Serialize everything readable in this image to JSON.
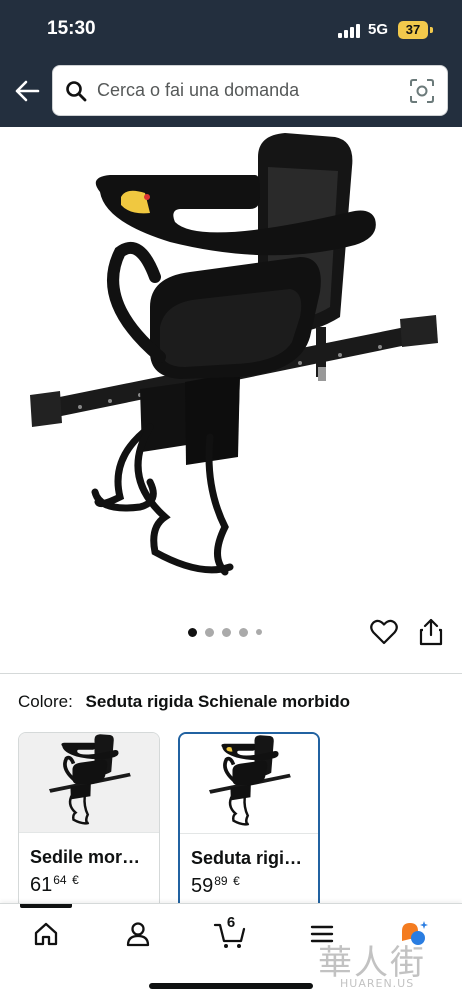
{
  "status_bar": {
    "time": "15:30",
    "network": "5G",
    "battery": "37"
  },
  "header": {
    "search_placeholder": "Cerca o fai una domanda",
    "icons": [
      "back-arrow-icon",
      "search-icon",
      "camera-scan-icon"
    ]
  },
  "product": {
    "image_alt": "Seggiolino bici anteriore per bambini",
    "gallery_count": 5,
    "gallery_active_index": 0
  },
  "color_selector": {
    "label": "Colore:",
    "selected_value": "Seduta rigida Schienale morbido"
  },
  "variants": [
    {
      "name": "Sedile mor…",
      "price_whole": "61",
      "price_fraction": "64",
      "currency": "€",
      "selected": false
    },
    {
      "name": "Seduta rigi…",
      "price_whole": "59",
      "price_fraction": "89",
      "currency": "€",
      "selected": true
    }
  ],
  "bottom_nav": {
    "items": [
      "home-icon",
      "account-icon",
      "cart-icon",
      "menu-icon",
      "ai-assistant-icon"
    ],
    "cart_count": "6",
    "active": "home"
  },
  "watermark": {
    "cn": "華人街",
    "en": "HUAREN.US"
  },
  "colors": {
    "header_bg": "#232f3e",
    "battery": "#f2c94c",
    "selected_border": "#2162a1",
    "assistant_orange": "#f47c20",
    "assistant_blue": "#2a7de1"
  }
}
